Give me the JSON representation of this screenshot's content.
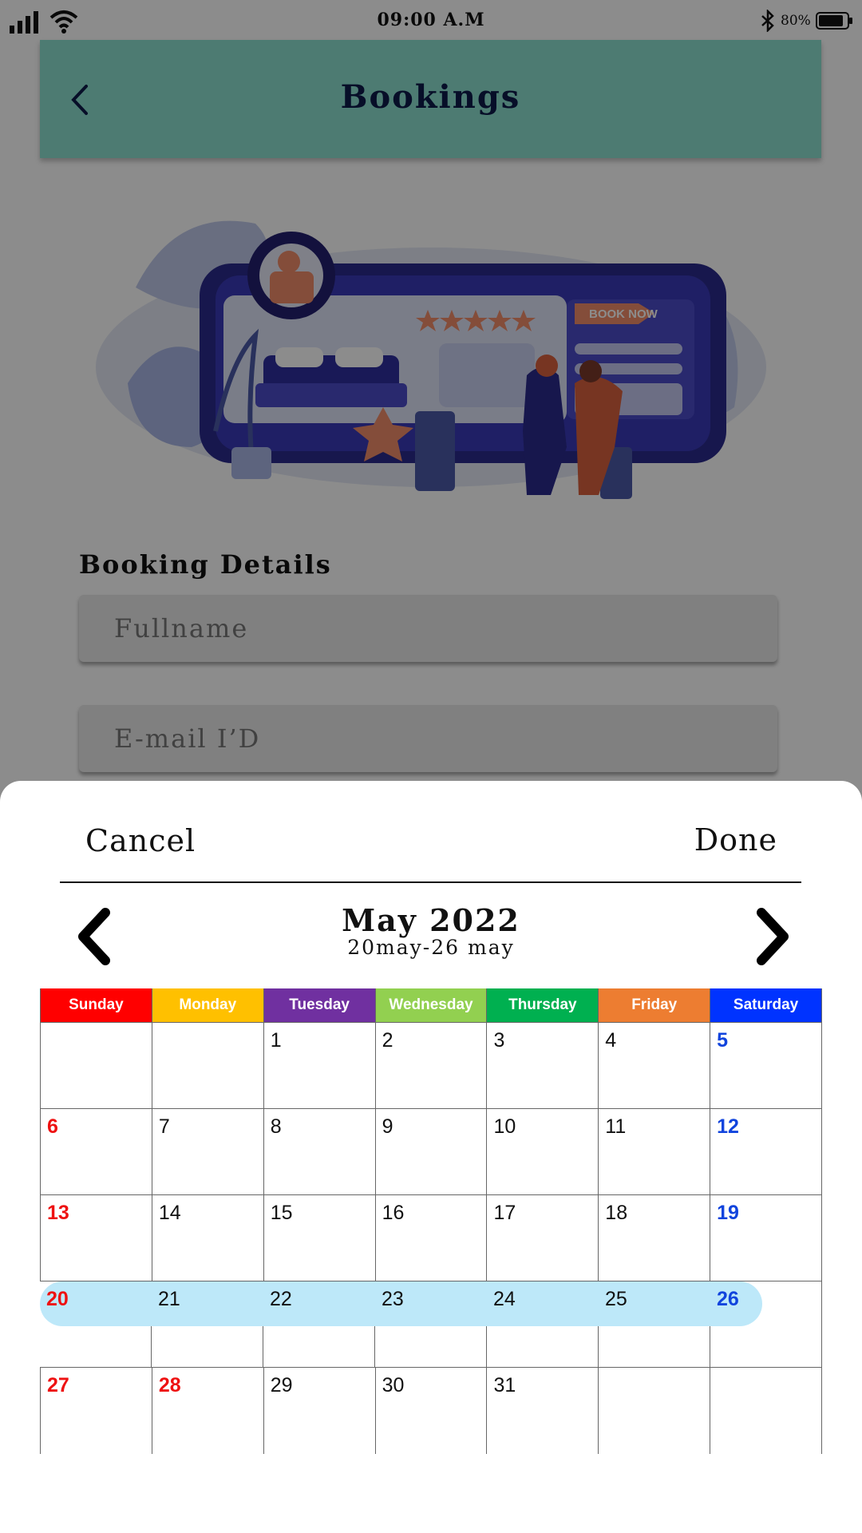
{
  "status": {
    "time": "09:00 A.M",
    "battery": "80%"
  },
  "header": {
    "title": "Bookings"
  },
  "illustration": {
    "cta": "BOOK NOW"
  },
  "form": {
    "section_title": "Booking Details",
    "fullname_placeholder": "Fullname",
    "email_placeholder": "E-mail I’D"
  },
  "sheet": {
    "cancel": "Cancel",
    "done": "Done",
    "month_title": "May 2022",
    "range": "20may-26 may"
  },
  "calendar": {
    "weekdays": [
      {
        "label": "Sunday",
        "color": "#ff0000"
      },
      {
        "label": "Monday",
        "color": "#ffc000"
      },
      {
        "label": "Tuesday",
        "color": "#7030a0"
      },
      {
        "label": "Wednesday",
        "color": "#92d050"
      },
      {
        "label": "Thursday",
        "color": "#00b050"
      },
      {
        "label": "Friday",
        "color": "#ed7d31"
      },
      {
        "label": "Saturday",
        "color": "#0033ff"
      }
    ],
    "weeks": [
      [
        "",
        "",
        "1",
        "2",
        "3",
        "4",
        "5"
      ],
      [
        "6",
        "7",
        "8",
        "9",
        "10",
        "11",
        "12"
      ],
      [
        "13",
        "14",
        "15",
        "16",
        "17",
        "18",
        "19"
      ],
      [
        "20",
        "21",
        "22",
        "23",
        "24",
        "25",
        "26"
      ],
      [
        "27",
        "28",
        "29",
        "30",
        "31",
        "",
        ""
      ]
    ],
    "red_days": [
      "6",
      "13",
      "20",
      "27",
      "28"
    ],
    "blue_days": [
      "5",
      "12",
      "19",
      "26"
    ],
    "selected_range": [
      "20",
      "26"
    ],
    "selection_color": "#bde8f9"
  }
}
